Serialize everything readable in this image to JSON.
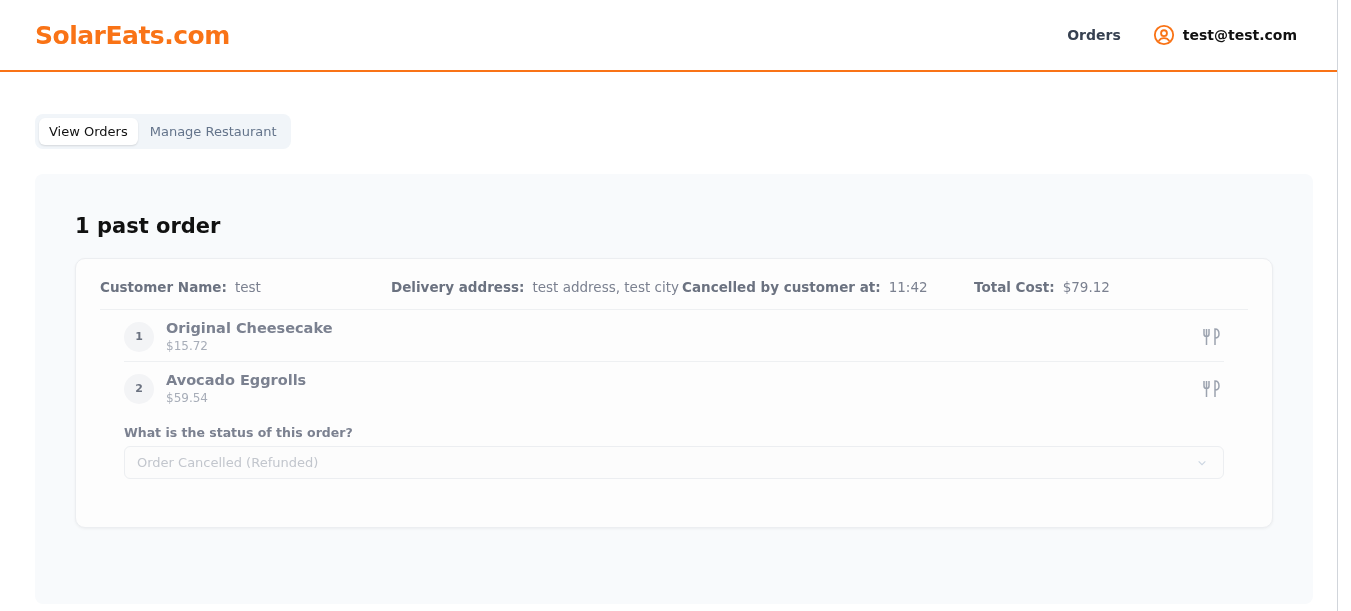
{
  "header": {
    "logo": "SolarEats.com",
    "nav": [
      {
        "label": "Orders"
      }
    ],
    "user": {
      "email": "test@test.com"
    }
  },
  "tabs": [
    {
      "label": "View Orders",
      "selected": true
    },
    {
      "label": "Manage Restaurant",
      "selected": false
    }
  ],
  "panel": {
    "heading": "1 past order",
    "orders": [
      {
        "fields": [
          {
            "label": "Customer Name:",
            "value": "test"
          },
          {
            "label": "Delivery address:",
            "value": "test address, test city"
          },
          {
            "label": "Cancelled by customer at:",
            "value": "11:42"
          },
          {
            "label": "Total Cost:",
            "value": "$79.12"
          }
        ],
        "items": [
          {
            "number": "1",
            "name": "Original Cheesecake",
            "price": "$15.72"
          },
          {
            "number": "2",
            "name": "Avocado Eggrolls",
            "price": "$59.54"
          }
        ],
        "status": {
          "label": "What is the status of this order?",
          "value": "Order Cancelled (Refunded)",
          "disabled": true
        }
      }
    ]
  }
}
